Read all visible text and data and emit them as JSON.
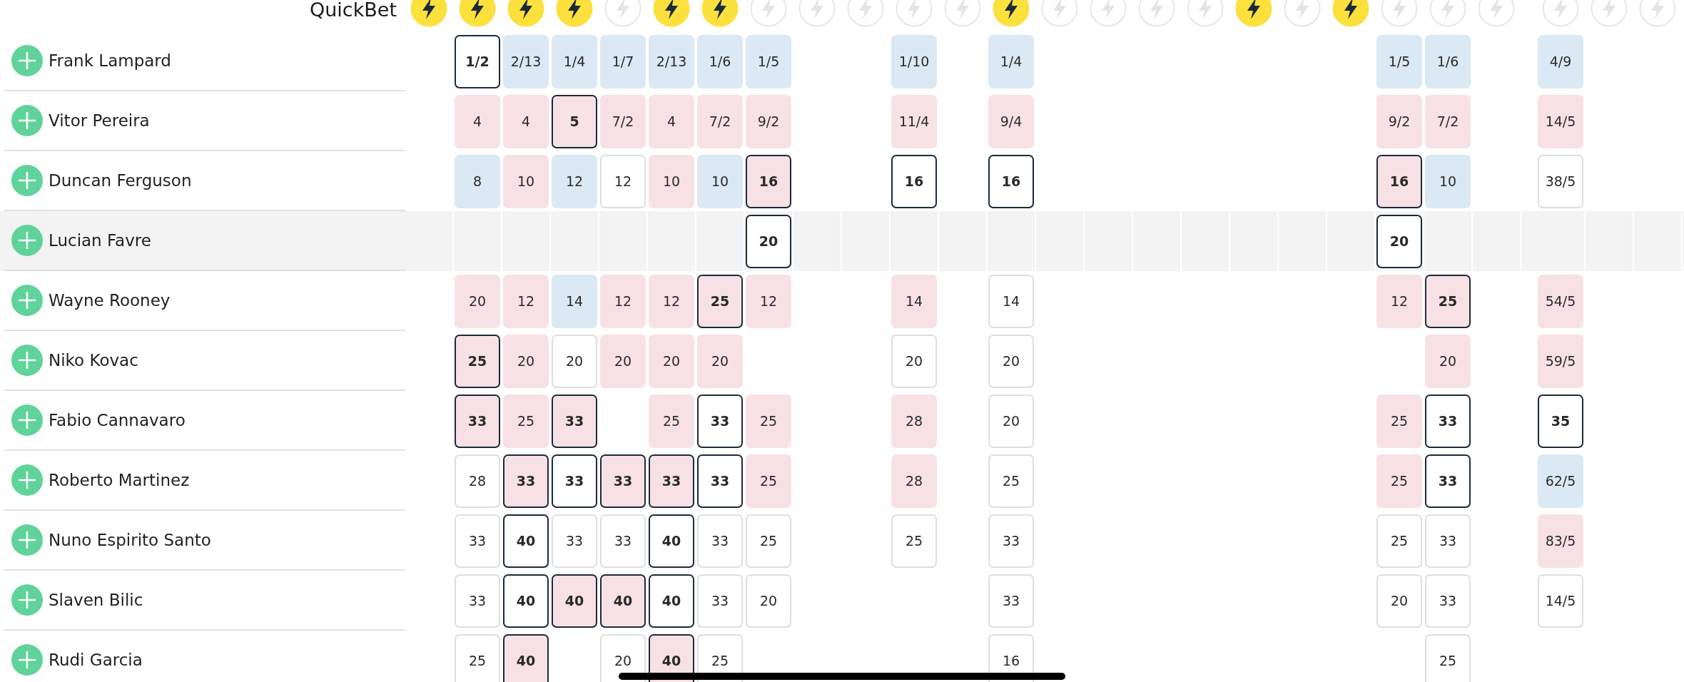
{
  "header": {
    "label": "QuickBet"
  },
  "bookmakers": [
    {
      "quickbet": true
    },
    {
      "quickbet": true
    },
    {
      "quickbet": true
    },
    {
      "quickbet": true
    },
    {
      "quickbet": false
    },
    {
      "quickbet": true
    },
    {
      "quickbet": true
    },
    {
      "quickbet": false
    },
    {
      "quickbet": false
    },
    {
      "quickbet": false
    },
    {
      "quickbet": false
    },
    {
      "quickbet": false
    },
    {
      "quickbet": true
    },
    {
      "quickbet": false
    },
    {
      "quickbet": false
    },
    {
      "quickbet": false
    },
    {
      "quickbet": false
    },
    {
      "quickbet": true
    },
    {
      "quickbet": false
    },
    {
      "quickbet": true
    },
    {
      "quickbet": false
    },
    {
      "quickbet": false
    },
    {
      "quickbet": false
    },
    {
      "quickbet": false
    },
    {
      "quickbet": false
    },
    {
      "quickbet": false
    }
  ],
  "runners": [
    {
      "name": "Frank Lampard",
      "selected": false,
      "odds": [
        {
          "kind": "empty"
        },
        {
          "kind": "price",
          "value": "1/2",
          "color": "#ffffff",
          "best": true
        },
        {
          "kind": "price",
          "value": "2/13",
          "color": "#dbe9f5",
          "best": false
        },
        {
          "kind": "price",
          "value": "1/4",
          "color": "#dbe9f5",
          "best": false
        },
        {
          "kind": "price",
          "value": "1/7",
          "color": "#dbe9f5",
          "best": false
        },
        {
          "kind": "price",
          "value": "2/13",
          "color": "#dbe9f5",
          "best": false
        },
        {
          "kind": "price",
          "value": "1/6",
          "color": "#dbe9f5",
          "best": false
        },
        {
          "kind": "price",
          "value": "1/5",
          "color": "#dbe9f5",
          "best": false
        },
        {
          "kind": "empty"
        },
        {
          "kind": "empty"
        },
        {
          "kind": "price",
          "value": "1/10",
          "color": "#dbe9f5",
          "best": false
        },
        {
          "kind": "empty"
        },
        {
          "kind": "price",
          "value": "1/4",
          "color": "#dbe9f5",
          "best": false
        },
        {
          "kind": "empty"
        },
        {
          "kind": "empty"
        },
        {
          "kind": "empty"
        },
        {
          "kind": "empty"
        },
        {
          "kind": "empty"
        },
        {
          "kind": "empty"
        },
        {
          "kind": "empty"
        },
        {
          "kind": "price",
          "value": "1/5",
          "color": "#dbe9f5",
          "best": false
        },
        {
          "kind": "price",
          "value": "1/6",
          "color": "#dbe9f5",
          "best": false
        },
        {
          "kind": "empty"
        },
        {
          "kind": "price",
          "value": "4/9",
          "color": "#dbe9f5",
          "best": false
        },
        {
          "kind": "empty"
        },
        {
          "kind": "empty"
        }
      ]
    },
    {
      "name": "Vitor Pereira",
      "selected": false,
      "odds": [
        {
          "kind": "empty"
        },
        {
          "kind": "price",
          "value": "4",
          "color": "#f8e1e5",
          "best": false
        },
        {
          "kind": "price",
          "value": "4",
          "color": "#f8e1e5",
          "best": false
        },
        {
          "kind": "price",
          "value": "5",
          "color": "#f8e1e5",
          "best": true
        },
        {
          "kind": "price",
          "value": "7/2",
          "color": "#f8e1e5",
          "best": false
        },
        {
          "kind": "price",
          "value": "4",
          "color": "#f8e1e5",
          "best": false
        },
        {
          "kind": "price",
          "value": "7/2",
          "color": "#f8e1e5",
          "best": false
        },
        {
          "kind": "price",
          "value": "9/2",
          "color": "#f8e1e5",
          "best": false
        },
        {
          "kind": "empty"
        },
        {
          "kind": "empty"
        },
        {
          "kind": "price",
          "value": "11/4",
          "color": "#f8e1e5",
          "best": false
        },
        {
          "kind": "empty"
        },
        {
          "kind": "price",
          "value": "9/4",
          "color": "#f8e1e5",
          "best": false
        },
        {
          "kind": "empty"
        },
        {
          "kind": "empty"
        },
        {
          "kind": "empty"
        },
        {
          "kind": "empty"
        },
        {
          "kind": "empty"
        },
        {
          "kind": "empty"
        },
        {
          "kind": "empty"
        },
        {
          "kind": "price",
          "value": "9/2",
          "color": "#f8e1e5",
          "best": false
        },
        {
          "kind": "price",
          "value": "7/2",
          "color": "#f8e1e5",
          "best": false
        },
        {
          "kind": "empty"
        },
        {
          "kind": "price",
          "value": "14/5",
          "color": "#f8e1e5",
          "best": false
        },
        {
          "kind": "empty"
        },
        {
          "kind": "empty"
        }
      ]
    },
    {
      "name": "Duncan Ferguson",
      "selected": false,
      "odds": [
        {
          "kind": "empty"
        },
        {
          "kind": "price",
          "value": "8",
          "color": "#dbe9f5",
          "best": false
        },
        {
          "kind": "price",
          "value": "10",
          "color": "#f8e1e5",
          "best": false
        },
        {
          "kind": "price",
          "value": "12",
          "color": "#dbe9f5",
          "best": false
        },
        {
          "kind": "price",
          "value": "12",
          "color": "#ffffff",
          "best": false
        },
        {
          "kind": "price",
          "value": "10",
          "color": "#f8e1e5",
          "best": false
        },
        {
          "kind": "price",
          "value": "10",
          "color": "#dbe9f5",
          "best": false
        },
        {
          "kind": "price",
          "value": "16",
          "color": "#f8e1e5",
          "best": true
        },
        {
          "kind": "empty"
        },
        {
          "kind": "empty"
        },
        {
          "kind": "price",
          "value": "16",
          "color": "#ffffff",
          "best": true
        },
        {
          "kind": "empty"
        },
        {
          "kind": "price",
          "value": "16",
          "color": "#ffffff",
          "best": true
        },
        {
          "kind": "empty"
        },
        {
          "kind": "empty"
        },
        {
          "kind": "empty"
        },
        {
          "kind": "empty"
        },
        {
          "kind": "empty"
        },
        {
          "kind": "empty"
        },
        {
          "kind": "empty"
        },
        {
          "kind": "price",
          "value": "16",
          "color": "#f8e1e5",
          "best": true
        },
        {
          "kind": "price",
          "value": "10",
          "color": "#dbe9f5",
          "best": false
        },
        {
          "kind": "empty"
        },
        {
          "kind": "price",
          "value": "38/5",
          "color": "#ffffff",
          "best": false
        },
        {
          "kind": "empty"
        },
        {
          "kind": "empty"
        }
      ]
    },
    {
      "name": "Lucian Favre",
      "selected": true,
      "odds": [
        {
          "kind": "empty"
        },
        {
          "kind": "empty"
        },
        {
          "kind": "empty"
        },
        {
          "kind": "empty"
        },
        {
          "kind": "empty"
        },
        {
          "kind": "empty"
        },
        {
          "kind": "empty"
        },
        {
          "kind": "price",
          "value": "20",
          "color": "#ffffff",
          "best": true
        },
        {
          "kind": "empty"
        },
        {
          "kind": "empty"
        },
        {
          "kind": "empty"
        },
        {
          "kind": "empty"
        },
        {
          "kind": "empty"
        },
        {
          "kind": "empty"
        },
        {
          "kind": "empty"
        },
        {
          "kind": "empty"
        },
        {
          "kind": "empty"
        },
        {
          "kind": "empty"
        },
        {
          "kind": "empty"
        },
        {
          "kind": "empty"
        },
        {
          "kind": "price",
          "value": "20",
          "color": "#ffffff",
          "best": true
        },
        {
          "kind": "empty"
        },
        {
          "kind": "empty"
        },
        {
          "kind": "empty"
        },
        {
          "kind": "empty"
        },
        {
          "kind": "empty"
        }
      ]
    },
    {
      "name": "Wayne Rooney",
      "selected": false,
      "odds": [
        {
          "kind": "empty"
        },
        {
          "kind": "price",
          "value": "20",
          "color": "#f8e1e5",
          "best": false
        },
        {
          "kind": "price",
          "value": "12",
          "color": "#f8e1e5",
          "best": false
        },
        {
          "kind": "price",
          "value": "14",
          "color": "#dbe9f5",
          "best": false
        },
        {
          "kind": "price",
          "value": "12",
          "color": "#f8e1e5",
          "best": false
        },
        {
          "kind": "price",
          "value": "12",
          "color": "#f8e1e5",
          "best": false
        },
        {
          "kind": "price",
          "value": "25",
          "color": "#f8e1e5",
          "best": true
        },
        {
          "kind": "price",
          "value": "12",
          "color": "#f8e1e5",
          "best": false
        },
        {
          "kind": "empty"
        },
        {
          "kind": "empty"
        },
        {
          "kind": "price",
          "value": "14",
          "color": "#f8e1e5",
          "best": false
        },
        {
          "kind": "empty"
        },
        {
          "kind": "price",
          "value": "14",
          "color": "#ffffff",
          "best": false
        },
        {
          "kind": "empty"
        },
        {
          "kind": "empty"
        },
        {
          "kind": "empty"
        },
        {
          "kind": "empty"
        },
        {
          "kind": "empty"
        },
        {
          "kind": "empty"
        },
        {
          "kind": "empty"
        },
        {
          "kind": "price",
          "value": "12",
          "color": "#f8e1e5",
          "best": false
        },
        {
          "kind": "price",
          "value": "25",
          "color": "#f8e1e5",
          "best": true
        },
        {
          "kind": "empty"
        },
        {
          "kind": "price",
          "value": "54/5",
          "color": "#f8e1e5",
          "best": false
        },
        {
          "kind": "empty"
        },
        {
          "kind": "empty"
        }
      ]
    },
    {
      "name": "Niko Kovac",
      "selected": false,
      "odds": [
        {
          "kind": "empty"
        },
        {
          "kind": "price",
          "value": "25",
          "color": "#f8e1e5",
          "best": true
        },
        {
          "kind": "price",
          "value": "20",
          "color": "#f8e1e5",
          "best": false
        },
        {
          "kind": "price",
          "value": "20",
          "color": "#ffffff",
          "best": false
        },
        {
          "kind": "price",
          "value": "20",
          "color": "#f8e1e5",
          "best": false
        },
        {
          "kind": "price",
          "value": "20",
          "color": "#f8e1e5",
          "best": false
        },
        {
          "kind": "price",
          "value": "20",
          "color": "#f8e1e5",
          "best": false
        },
        {
          "kind": "empty"
        },
        {
          "kind": "empty"
        },
        {
          "kind": "empty"
        },
        {
          "kind": "price",
          "value": "20",
          "color": "#ffffff",
          "best": false
        },
        {
          "kind": "empty"
        },
        {
          "kind": "price",
          "value": "20",
          "color": "#ffffff",
          "best": false
        },
        {
          "kind": "empty"
        },
        {
          "kind": "empty"
        },
        {
          "kind": "empty"
        },
        {
          "kind": "empty"
        },
        {
          "kind": "empty"
        },
        {
          "kind": "empty"
        },
        {
          "kind": "empty"
        },
        {
          "kind": "empty"
        },
        {
          "kind": "price",
          "value": "20",
          "color": "#f8e1e5",
          "best": false
        },
        {
          "kind": "empty"
        },
        {
          "kind": "price",
          "value": "59/5",
          "color": "#f8e1e5",
          "best": false
        },
        {
          "kind": "empty"
        },
        {
          "kind": "empty"
        }
      ]
    },
    {
      "name": "Fabio Cannavaro",
      "selected": false,
      "odds": [
        {
          "kind": "empty"
        },
        {
          "kind": "price",
          "value": "33",
          "color": "#f8e1e5",
          "best": true
        },
        {
          "kind": "price",
          "value": "25",
          "color": "#f8e1e5",
          "best": false
        },
        {
          "kind": "price",
          "value": "33",
          "color": "#f8e1e5",
          "best": true
        },
        {
          "kind": "empty"
        },
        {
          "kind": "price",
          "value": "25",
          "color": "#f8e1e5",
          "best": false
        },
        {
          "kind": "price",
          "value": "33",
          "color": "#ffffff",
          "best": true
        },
        {
          "kind": "price",
          "value": "25",
          "color": "#f8e1e5",
          "best": false
        },
        {
          "kind": "empty"
        },
        {
          "kind": "empty"
        },
        {
          "kind": "price",
          "value": "28",
          "color": "#f8e1e5",
          "best": false
        },
        {
          "kind": "empty"
        },
        {
          "kind": "price",
          "value": "20",
          "color": "#ffffff",
          "best": false
        },
        {
          "kind": "empty"
        },
        {
          "kind": "empty"
        },
        {
          "kind": "empty"
        },
        {
          "kind": "empty"
        },
        {
          "kind": "empty"
        },
        {
          "kind": "empty"
        },
        {
          "kind": "empty"
        },
        {
          "kind": "price",
          "value": "25",
          "color": "#f8e1e5",
          "best": false
        },
        {
          "kind": "price",
          "value": "33",
          "color": "#ffffff",
          "best": true
        },
        {
          "kind": "empty"
        },
        {
          "kind": "price",
          "value": "35",
          "color": "#ffffff",
          "best": true
        },
        {
          "kind": "empty"
        },
        {
          "kind": "empty"
        }
      ]
    },
    {
      "name": "Roberto Martinez",
      "selected": false,
      "odds": [
        {
          "kind": "empty"
        },
        {
          "kind": "price",
          "value": "28",
          "color": "#ffffff",
          "best": false
        },
        {
          "kind": "price",
          "value": "33",
          "color": "#f8e1e5",
          "best": true
        },
        {
          "kind": "price",
          "value": "33",
          "color": "#ffffff",
          "best": true
        },
        {
          "kind": "price",
          "value": "33",
          "color": "#f8e1e5",
          "best": true
        },
        {
          "kind": "price",
          "value": "33",
          "color": "#f8e1e5",
          "best": true
        },
        {
          "kind": "price",
          "value": "33",
          "color": "#ffffff",
          "best": true
        },
        {
          "kind": "price",
          "value": "25",
          "color": "#f8e1e5",
          "best": false
        },
        {
          "kind": "empty"
        },
        {
          "kind": "empty"
        },
        {
          "kind": "price",
          "value": "28",
          "color": "#f8e1e5",
          "best": false
        },
        {
          "kind": "empty"
        },
        {
          "kind": "price",
          "value": "25",
          "color": "#ffffff",
          "best": false
        },
        {
          "kind": "empty"
        },
        {
          "kind": "empty"
        },
        {
          "kind": "empty"
        },
        {
          "kind": "empty"
        },
        {
          "kind": "empty"
        },
        {
          "kind": "empty"
        },
        {
          "kind": "empty"
        },
        {
          "kind": "price",
          "value": "25",
          "color": "#f8e1e5",
          "best": false
        },
        {
          "kind": "price",
          "value": "33",
          "color": "#ffffff",
          "best": true
        },
        {
          "kind": "empty"
        },
        {
          "kind": "price",
          "value": "62/5",
          "color": "#dbe9f5",
          "best": false
        },
        {
          "kind": "empty"
        },
        {
          "kind": "empty"
        }
      ]
    },
    {
      "name": "Nuno Espirito Santo",
      "selected": false,
      "odds": [
        {
          "kind": "empty"
        },
        {
          "kind": "price",
          "value": "33",
          "color": "#ffffff",
          "best": false
        },
        {
          "kind": "price",
          "value": "40",
          "color": "#ffffff",
          "best": true
        },
        {
          "kind": "price",
          "value": "33",
          "color": "#ffffff",
          "best": false
        },
        {
          "kind": "price",
          "value": "33",
          "color": "#ffffff",
          "best": false
        },
        {
          "kind": "price",
          "value": "40",
          "color": "#ffffff",
          "best": true
        },
        {
          "kind": "price",
          "value": "33",
          "color": "#ffffff",
          "best": false
        },
        {
          "kind": "price",
          "value": "25",
          "color": "#ffffff",
          "best": false
        },
        {
          "kind": "empty"
        },
        {
          "kind": "empty"
        },
        {
          "kind": "price",
          "value": "25",
          "color": "#ffffff",
          "best": false
        },
        {
          "kind": "empty"
        },
        {
          "kind": "price",
          "value": "33",
          "color": "#ffffff",
          "best": false
        },
        {
          "kind": "empty"
        },
        {
          "kind": "empty"
        },
        {
          "kind": "empty"
        },
        {
          "kind": "empty"
        },
        {
          "kind": "empty"
        },
        {
          "kind": "empty"
        },
        {
          "kind": "empty"
        },
        {
          "kind": "price",
          "value": "25",
          "color": "#ffffff",
          "best": false
        },
        {
          "kind": "price",
          "value": "33",
          "color": "#ffffff",
          "best": false
        },
        {
          "kind": "empty"
        },
        {
          "kind": "price",
          "value": "83/5",
          "color": "#f8e1e5",
          "best": false
        },
        {
          "kind": "empty"
        },
        {
          "kind": "empty"
        }
      ]
    },
    {
      "name": "Slaven Bilic",
      "selected": false,
      "odds": [
        {
          "kind": "empty"
        },
        {
          "kind": "price",
          "value": "33",
          "color": "#ffffff",
          "best": false
        },
        {
          "kind": "price",
          "value": "40",
          "color": "#ffffff",
          "best": true
        },
        {
          "kind": "price",
          "value": "40",
          "color": "#f8e1e5",
          "best": true
        },
        {
          "kind": "price",
          "value": "40",
          "color": "#f8e1e5",
          "best": true
        },
        {
          "kind": "price",
          "value": "40",
          "color": "#ffffff",
          "best": true
        },
        {
          "kind": "price",
          "value": "33",
          "color": "#ffffff",
          "best": false
        },
        {
          "kind": "price",
          "value": "20",
          "color": "#ffffff",
          "best": false
        },
        {
          "kind": "empty"
        },
        {
          "kind": "empty"
        },
        {
          "kind": "empty"
        },
        {
          "kind": "empty"
        },
        {
          "kind": "price",
          "value": "33",
          "color": "#ffffff",
          "best": false
        },
        {
          "kind": "empty"
        },
        {
          "kind": "empty"
        },
        {
          "kind": "empty"
        },
        {
          "kind": "empty"
        },
        {
          "kind": "empty"
        },
        {
          "kind": "empty"
        },
        {
          "kind": "empty"
        },
        {
          "kind": "price",
          "value": "20",
          "color": "#ffffff",
          "best": false
        },
        {
          "kind": "price",
          "value": "33",
          "color": "#ffffff",
          "best": false
        },
        {
          "kind": "empty"
        },
        {
          "kind": "price",
          "value": "14/5",
          "color": "#ffffff",
          "best": false
        },
        {
          "kind": "empty"
        },
        {
          "kind": "empty"
        }
      ]
    },
    {
      "name": "Rudi Garcia",
      "selected": false,
      "odds": [
        {
          "kind": "empty"
        },
        {
          "kind": "price",
          "value": "25",
          "color": "#ffffff",
          "best": false
        },
        {
          "kind": "price",
          "value": "40",
          "color": "#f8e1e5",
          "best": true
        },
        {
          "kind": "empty"
        },
        {
          "kind": "price",
          "value": "20",
          "color": "#ffffff",
          "best": false
        },
        {
          "kind": "price",
          "value": "40",
          "color": "#f8e1e5",
          "best": true
        },
        {
          "kind": "price",
          "value": "25",
          "color": "#ffffff",
          "best": false
        },
        {
          "kind": "empty"
        },
        {
          "kind": "empty"
        },
        {
          "kind": "empty"
        },
        {
          "kind": "empty"
        },
        {
          "kind": "empty"
        },
        {
          "kind": "price",
          "value": "16",
          "color": "#ffffff",
          "best": false
        },
        {
          "kind": "empty"
        },
        {
          "kind": "empty"
        },
        {
          "kind": "empty"
        },
        {
          "kind": "empty"
        },
        {
          "kind": "empty"
        },
        {
          "kind": "empty"
        },
        {
          "kind": "empty"
        },
        {
          "kind": "empty"
        },
        {
          "kind": "price",
          "value": "25",
          "color": "#ffffff",
          "best": false
        },
        {
          "kind": "empty"
        },
        {
          "kind": "empty"
        },
        {
          "kind": "empty"
        },
        {
          "kind": "empty"
        }
      ]
    }
  ]
}
